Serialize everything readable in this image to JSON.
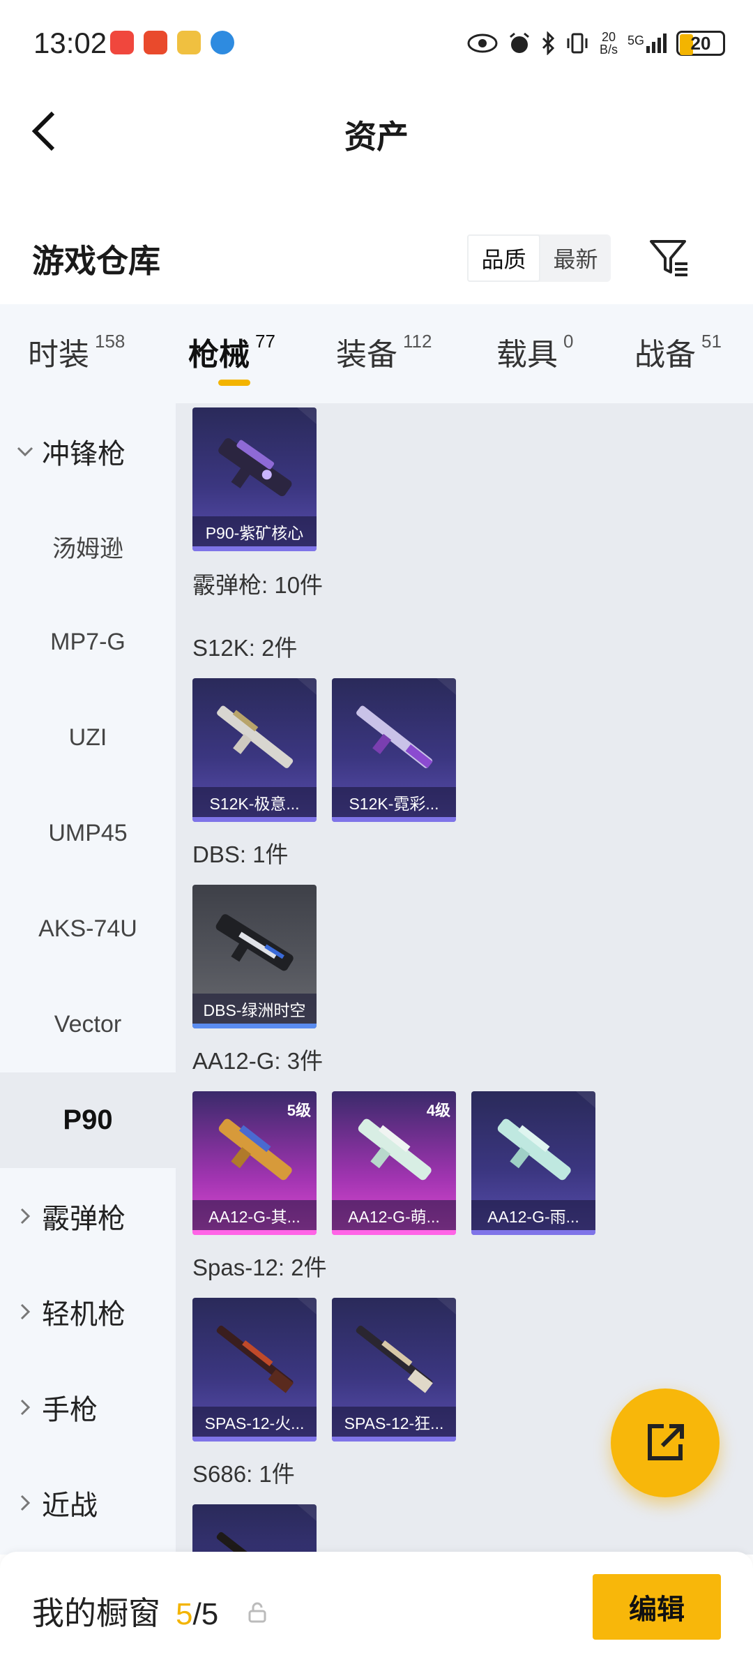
{
  "status_bar": {
    "time": "13:02",
    "net_speed_value": "20",
    "net_speed_unit": "B/s",
    "signal_label": "5G",
    "battery": "20"
  },
  "header": {
    "title": "资产",
    "back_icon": "chevron-left-icon"
  },
  "warehouse": {
    "title": "游戏仓库",
    "sort_options": [
      "品质",
      "最新"
    ],
    "sort_selected": "品质",
    "filter_icon": "filter-icon"
  },
  "tabs": [
    {
      "label": "时装",
      "count": "158"
    },
    {
      "label": "枪械",
      "count": "77"
    },
    {
      "label": "装备",
      "count": "112"
    },
    {
      "label": "载具",
      "count": "0"
    },
    {
      "label": "战备",
      "count": "51"
    }
  ],
  "sidebar": {
    "group_smg": "冲锋枪",
    "items": [
      "汤姆逊",
      "MP7-G",
      "UZI",
      "UMP45",
      "AKS-74U",
      "Vector",
      "P90"
    ],
    "selected": "P90",
    "groups": [
      "霰弹枪",
      "轻机枪",
      "手枪",
      "近战"
    ]
  },
  "content": {
    "p90_card": "P90-紫矿核心",
    "shotgun_summary": "霰弹枪: 10件",
    "sections": {
      "s12k": "S12K: 2件",
      "dbs": "DBS: 1件",
      "aa12": "AA12-G: 3件",
      "spas": "Spas-12: 2件",
      "s686": "S686: 1件"
    },
    "cards": {
      "s12k_1": "S12K-极意...",
      "s12k_2": "S12K-霓彩...",
      "dbs_1": "DBS-绿洲时空",
      "aa12_1": "AA12-G-其...",
      "aa12_1_level": "5级",
      "aa12_2": "AA12-G-萌...",
      "aa12_2_level": "4级",
      "aa12_3": "AA12-G-雨...",
      "spas_1": "SPAS-12-火...",
      "spas_2": "SPAS-12-狂..."
    }
  },
  "bottom_bar": {
    "showcase_label": "我的橱窗",
    "current": "5",
    "separator": "/",
    "total": "5",
    "edit_label": "编辑"
  },
  "colors": {
    "accent": "#f8b70a",
    "tab_indicator": "#f3b400",
    "sidebar_bg": "#f4f7fb",
    "content_bg": "#e8ebf0"
  }
}
